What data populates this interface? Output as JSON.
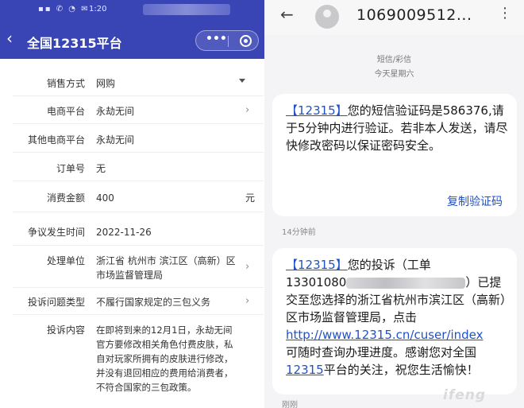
{
  "left": {
    "status": {
      "icons": "▪▪ ✆ ◔ ✉",
      "time": "1:20"
    },
    "nav": {
      "back_icon": "‹",
      "title": "全国12315平台",
      "capsule_dots": "•••"
    },
    "rows": [
      {
        "label": "销售方式",
        "value": "网购",
        "indicator": "caret"
      },
      {
        "label": "电商平台",
        "value": "永劫无间",
        "indicator": "chevron"
      },
      {
        "label": "其他电商平台",
        "value": "永劫无间",
        "indicator": "none"
      },
      {
        "label": "订单号",
        "value": "无",
        "indicator": "none"
      },
      {
        "label": "消费金额",
        "value": "400",
        "unit": "元",
        "indicator": "unit"
      },
      {
        "label": "争议发生时间",
        "value": "2022-11-26",
        "indicator": "none"
      },
      {
        "label": "处理单位",
        "value": "浙江省 杭州市 滨江区（高新）区市场监督管理局",
        "indicator": "chevron"
      },
      {
        "label": "投诉问题类型",
        "value": "不履行国家规定的三包义务",
        "indicator": "chevron"
      },
      {
        "label": "投诉内容",
        "value": "在即将到来的12月1日，永劫无间官方要修改相关角色付费皮肤，私自对玩家所拥有的皮肤进行修改，并没有退回相应的费用给消费者，不符合国家的三包政策。",
        "indicator": "none"
      }
    ]
  },
  "right": {
    "header": {
      "back_icon": "←",
      "number": "1069009512...",
      "more_icon": "⋮"
    },
    "subheader": {
      "type": "短信/彩信",
      "date": "今天星期六"
    },
    "msg1": {
      "tag": "【12315】",
      "text": "您的短信验证码是586376,请于5分钟内进行验证。若非本人发送，请尽快修改密码以保证密码安全。",
      "action": "复制验证码",
      "time": "14分钟前"
    },
    "msg2": {
      "tag": "【12315】",
      "part1": "您的投诉（工单",
      "num_prefix": "13301080",
      "part2": "）已提交至您选择的浙江省杭州市滨江区（高新）区市场监督管理局，点击",
      "link": "http://www.12315.cn/cuser/index",
      "part3": "可随时查询办理进度。感谢您对全国",
      "tag2": "12315",
      "part4": "平台的关注，祝您生活愉快！",
      "time": "刚刚"
    },
    "watermark": "ifeng"
  },
  "colors": {
    "nav_bg": "#3a45b5",
    "link": "#1f52c8",
    "bubble_bg": "#ffffff",
    "chat_bg": "#f4f4f6"
  }
}
